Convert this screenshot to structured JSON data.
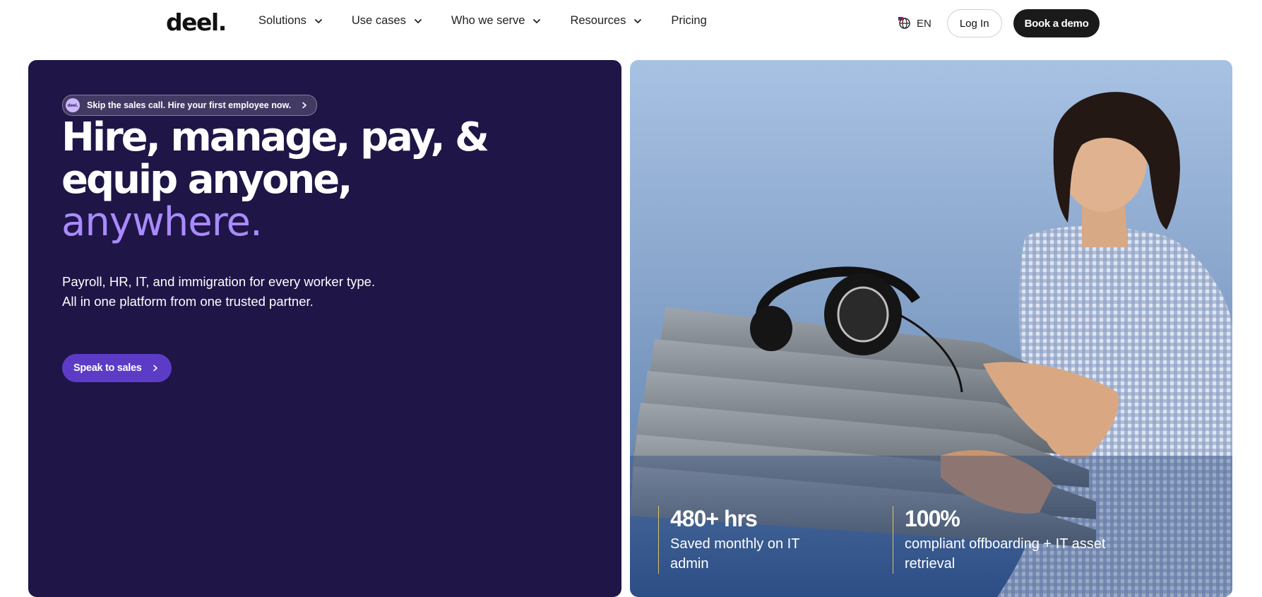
{
  "nav": {
    "logo": "deel.",
    "items": [
      {
        "label": "Solutions",
        "has_dropdown": true
      },
      {
        "label": "Use cases",
        "has_dropdown": true
      },
      {
        "label": "Who we serve",
        "has_dropdown": true
      },
      {
        "label": "Resources",
        "has_dropdown": true
      },
      {
        "label": "Pricing",
        "has_dropdown": false
      }
    ],
    "language": "EN",
    "login_label": "Log In",
    "demo_label": "Book a demo"
  },
  "hero": {
    "pill_badge": "deel.",
    "pill_text": "Skip the sales call. Hire your first employee now.",
    "headline_line1": "Hire, manage, pay, &",
    "headline_line2": "equip anyone,",
    "headline_accent": "anywhere.",
    "subtext_line1": "Payroll, HR, IT, and immigration for every worker type.",
    "subtext_line2": "All in one platform from one trusted partner.",
    "cta_label": "Speak to sales"
  },
  "stats": [
    {
      "value": "480+ hrs",
      "label_line1": "Saved monthly on IT",
      "label_line2": "admin"
    },
    {
      "value": "100%",
      "label_line1": "compliant offboarding + IT asset",
      "label_line2": "retrieval"
    }
  ],
  "colors": {
    "hero_bg": "#1f1547",
    "accent": "#a98bff",
    "cta": "#5c3cc7",
    "stat_divider": "#d9c26a"
  },
  "icons": {
    "dropdown": "chevron-down-icon",
    "language": "globe-icon",
    "pill_arrow": "chevron-right-icon",
    "cta_arrow": "chevron-right-icon"
  }
}
